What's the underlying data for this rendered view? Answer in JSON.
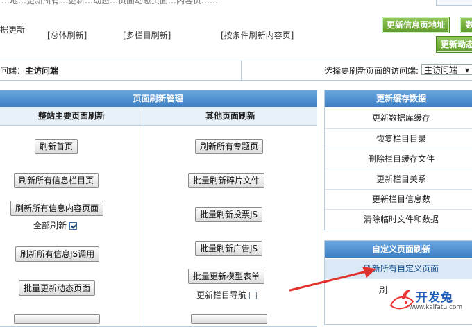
{
  "top_strip": {
    "text": "…地…更新所有…更新…动态…页面动态页面…内容页……"
  },
  "nav": {
    "partial_left": "据更新",
    "links": [
      "[总体刷新]",
      "[多栏目刷新]",
      "[按条件刷新内容页]"
    ],
    "green_buttons": [
      "更新信息页地址",
      "数",
      "更新动态"
    ]
  },
  "access": {
    "left_partial_label": "问端：",
    "left_value": "主访问端",
    "right_label": "选择要刷新页面的访问端:",
    "selected": "主访问端"
  },
  "page_refresh": {
    "title": "页面刷新管理",
    "col1_header": "整站主要页面刷新",
    "col2_header": "其他页面刷新",
    "col1_buttons": [
      "刷新首页",
      "刷新所有信息栏目页",
      "刷新所有信息内容页面",
      "刷新所有信息JS调用",
      "批量更新动态页面"
    ],
    "col1_checkbox_label": "全部刷新",
    "col2_buttons": [
      "刷新所有专题页",
      "批量刷新碎片文件",
      "批量刷新投票JS",
      "批量刷新广告JS",
      "批量更新模型表单"
    ],
    "col2_checkbox_label": "更新栏目导航"
  },
  "cache_panel": {
    "title": "更新缓存数据",
    "links": [
      "更新数据库缓存",
      "恢复栏目目录",
      "删除栏目缓存文件",
      "更新栏目关系",
      "更新栏目信息数",
      "清除临时文件和数据"
    ]
  },
  "custom_panel": {
    "title": "自定义页面刷新",
    "links": [
      "刷新所有自定义页面",
      "刷"
    ]
  },
  "watermark": {
    "text": "开发兔",
    "url": "www.kaifatu.com"
  },
  "colors": {
    "green": "#5d9a26",
    "blue": "#3d7fc4",
    "border": "#b9cde0",
    "arrow": "#e0322d"
  }
}
